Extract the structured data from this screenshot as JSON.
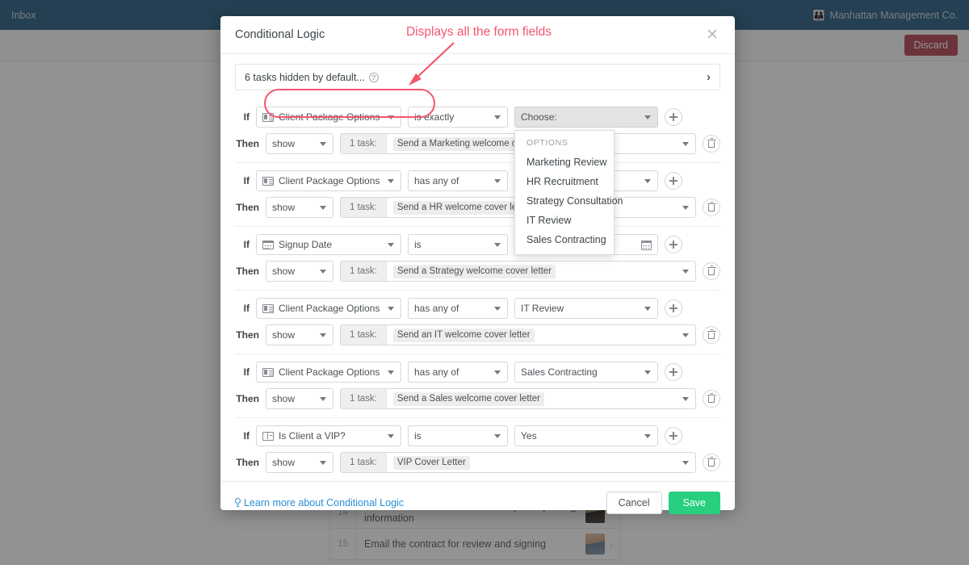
{
  "navbar": {
    "left_label": "Inbox",
    "org_name": "Manhattan Management Co.",
    "org_icon": "group-icon",
    "background_color": "#1a5479"
  },
  "subbar": {
    "discard_label": "Discard"
  },
  "background_tasks": [
    {
      "num": "14",
      "text": "Give directions to office and a map with parking information"
    },
    {
      "num": "15",
      "text": "Email the contract for review and signing"
    }
  ],
  "modal": {
    "title": "Conditional Logic",
    "close_icon": "close-icon",
    "hidden_bar": {
      "label": "6 tasks hidden by default...",
      "help_icon": "question-mark-icon",
      "expand_icon": "chevron-right-icon"
    },
    "labels": {
      "if": "If",
      "then": "Then",
      "task_count": "1 task:"
    },
    "rules": [
      {
        "field": "Client Package Options",
        "field_icon": "multi-select-icon",
        "operator": "is exactly",
        "value": "Choose:",
        "value_state": "placeholder",
        "action": "show",
        "task_count": "1 task:",
        "task": "Send a Marketing welcome cover letter"
      },
      {
        "field": "Client Package Options",
        "field_icon": "multi-select-icon",
        "operator": "has any of",
        "value": "",
        "value_state": "empty",
        "action": "show",
        "task_count": "1 task:",
        "task": "Send a HR welcome cover letter"
      },
      {
        "field": "Signup Date",
        "field_icon": "calendar-icon",
        "operator": "is",
        "value": "",
        "value_state": "date",
        "action": "show",
        "task_count": "1 task:",
        "task": "Send a Strategy welcome cover letter"
      },
      {
        "field": "Client Package Options",
        "field_icon": "multi-select-icon",
        "operator": "has any of",
        "value": "IT Review",
        "value_state": "filled",
        "action": "show",
        "task_count": "1 task:",
        "task": "Send an IT welcome cover letter"
      },
      {
        "field": "Client Package Options",
        "field_icon": "multi-select-icon",
        "operator": "has any of",
        "value": "Sales Contracting",
        "value_state": "filled",
        "action": "show",
        "task_count": "1 task:",
        "task": "Send a Sales welcome cover letter"
      },
      {
        "field": "Is Client a VIP?",
        "field_icon": "radio-select-icon",
        "operator": "is",
        "value": "Yes",
        "value_state": "filled",
        "action": "show",
        "task_count": "1 task:",
        "task": "VIP Cover Letter"
      }
    ],
    "dropdown": {
      "heading": "OPTIONS",
      "items": [
        "Marketing Review",
        "HR Recruitment",
        "Strategy Consultation",
        "IT Review",
        "Sales Contracting"
      ]
    },
    "footer": {
      "learn_more": "Learn more about Conditional Logic",
      "learn_more_icon": "lightbulb-icon",
      "cancel_label": "Cancel",
      "save_label": "Save",
      "save_color": "#27cf7f"
    }
  },
  "annotation": {
    "text": "Displays all the form fields",
    "color": "#f4556e"
  }
}
